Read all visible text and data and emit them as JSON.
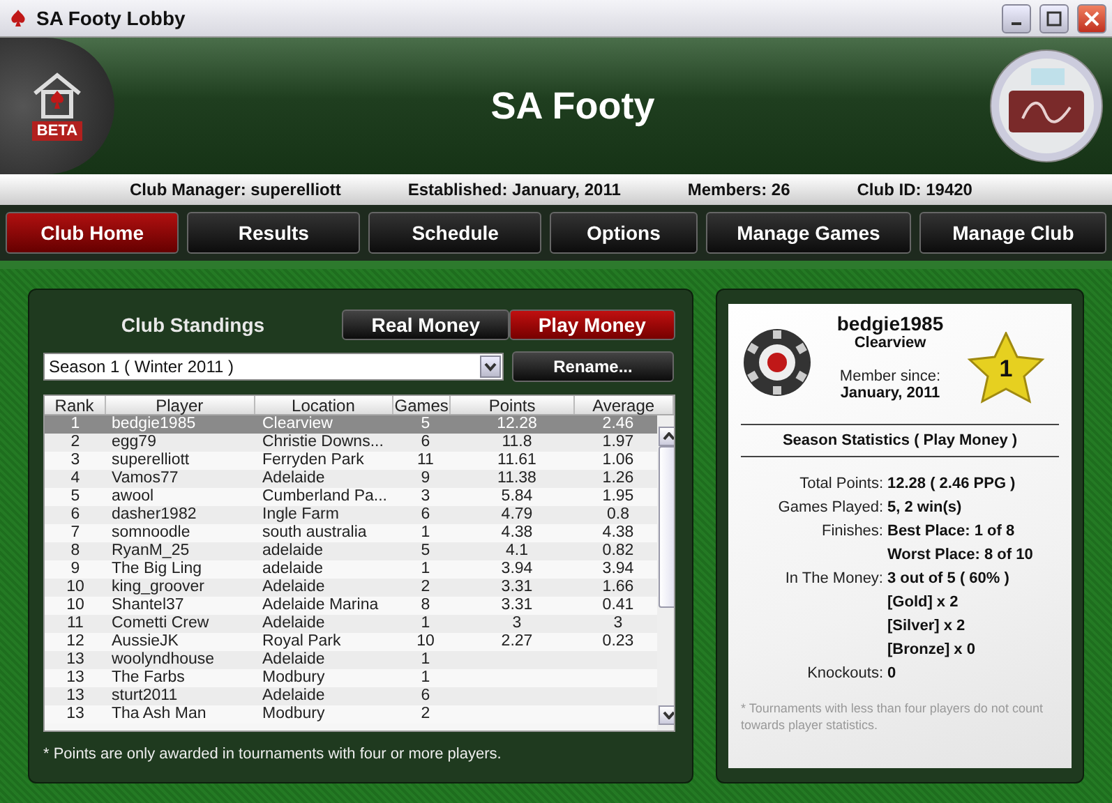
{
  "window": {
    "title": "SA Footy Lobby"
  },
  "header": {
    "title": "SA Footy",
    "badge": "BETA"
  },
  "info_bar": [
    "Club Manager: superelliott",
    "Established: January, 2011",
    "Members: 26",
    "Club ID: 19420"
  ],
  "nav_tabs": [
    {
      "label": "Club Home",
      "selected": true
    },
    {
      "label": "Results",
      "selected": false
    },
    {
      "label": "Schedule",
      "selected": false
    },
    {
      "label": "Options",
      "selected": false
    },
    {
      "label": "Manage Games",
      "selected": false
    },
    {
      "label": "Manage Club",
      "selected": false
    }
  ],
  "standings": {
    "title": "Club Standings",
    "money_tabs": [
      {
        "label": "Real Money",
        "selected": false
      },
      {
        "label": "Play Money",
        "selected": true
      }
    ],
    "season": "Season 1 ( Winter 2011 )",
    "rename_button": "Rename...",
    "columns": [
      "Rank",
      "Player",
      "Location",
      "Games",
      "Points",
      "Average"
    ],
    "rows": [
      {
        "cells": [
          "1",
          "bedgie1985",
          "Clearview",
          "5",
          "12.28",
          "2.46"
        ],
        "selected": true
      },
      {
        "cells": [
          "2",
          "egg79",
          "Christie Downs...",
          "6",
          "11.8",
          "1.97"
        ],
        "selected": false
      },
      {
        "cells": [
          "3",
          "superelliott",
          "Ferryden Park",
          "11",
          "11.61",
          "1.06"
        ],
        "selected": false
      },
      {
        "cells": [
          "4",
          "Vamos77",
          "Adelaide",
          "9",
          "11.38",
          "1.26"
        ],
        "selected": false
      },
      {
        "cells": [
          "5",
          "awool",
          "Cumberland Pa...",
          "3",
          "5.84",
          "1.95"
        ],
        "selected": false
      },
      {
        "cells": [
          "6",
          "dasher1982",
          "Ingle Farm",
          "6",
          "4.79",
          "0.8"
        ],
        "selected": false
      },
      {
        "cells": [
          "7",
          "somnoodle",
          "south australia",
          "1",
          "4.38",
          "4.38"
        ],
        "selected": false
      },
      {
        "cells": [
          "8",
          "RyanM_25",
          "adelaide",
          "5",
          "4.1",
          "0.82"
        ],
        "selected": false
      },
      {
        "cells": [
          "9",
          "The Big Ling",
          "adelaide",
          "1",
          "3.94",
          "3.94"
        ],
        "selected": false
      },
      {
        "cells": [
          "10",
          "king_groover",
          "Adelaide",
          "2",
          "3.31",
          "1.66"
        ],
        "selected": false
      },
      {
        "cells": [
          "10",
          "Shantel37",
          "Adelaide Marina",
          "8",
          "3.31",
          "0.41"
        ],
        "selected": false
      },
      {
        "cells": [
          "11",
          "Cometti Crew",
          "Adelaide",
          "1",
          "3",
          "3"
        ],
        "selected": false
      },
      {
        "cells": [
          "12",
          "AussieJK",
          "Royal Park",
          "10",
          "2.27",
          "0.23"
        ],
        "selected": false
      },
      {
        "cells": [
          "13",
          "woolyndhouse",
          "Adelaide",
          "1",
          "",
          ""
        ],
        "selected": false
      },
      {
        "cells": [
          "13",
          "The Farbs",
          "Modbury",
          "1",
          "",
          ""
        ],
        "selected": false
      },
      {
        "cells": [
          "13",
          "sturt2011",
          "Adelaide",
          "6",
          "",
          ""
        ],
        "selected": false
      },
      {
        "cells": [
          "13",
          "Tha Ash Man",
          "Modbury",
          "2",
          "",
          ""
        ],
        "selected": false
      }
    ],
    "footnote": "* Points are only awarded in tournaments with four or more players."
  },
  "profile": {
    "name": "bedgie1985",
    "location": "Clearview",
    "member_since_label": "Member since:",
    "member_since": "January, 2011",
    "rank": "1",
    "stats_title": "Season Statistics ( Play Money )",
    "stats": [
      {
        "label": "Total Points:",
        "values": [
          "12.28  ( 2.46 PPG )"
        ]
      },
      {
        "label": "Games Played:",
        "values": [
          "5, 2 win(s)"
        ]
      },
      {
        "label": "Finishes:",
        "values": [
          "Best Place: 1 of 8",
          "Worst Place: 8 of 10"
        ]
      },
      {
        "label": "In The Money:",
        "values": [
          "3 out of 5  ( 60% )",
          "[Gold] x 2",
          "[Silver] x 2",
          "[Bronze] x 0"
        ]
      },
      {
        "label": "Knockouts:",
        "values": [
          "0"
        ]
      }
    ],
    "footnote": "* Tournaments with less than four players do not count towards player statistics."
  }
}
